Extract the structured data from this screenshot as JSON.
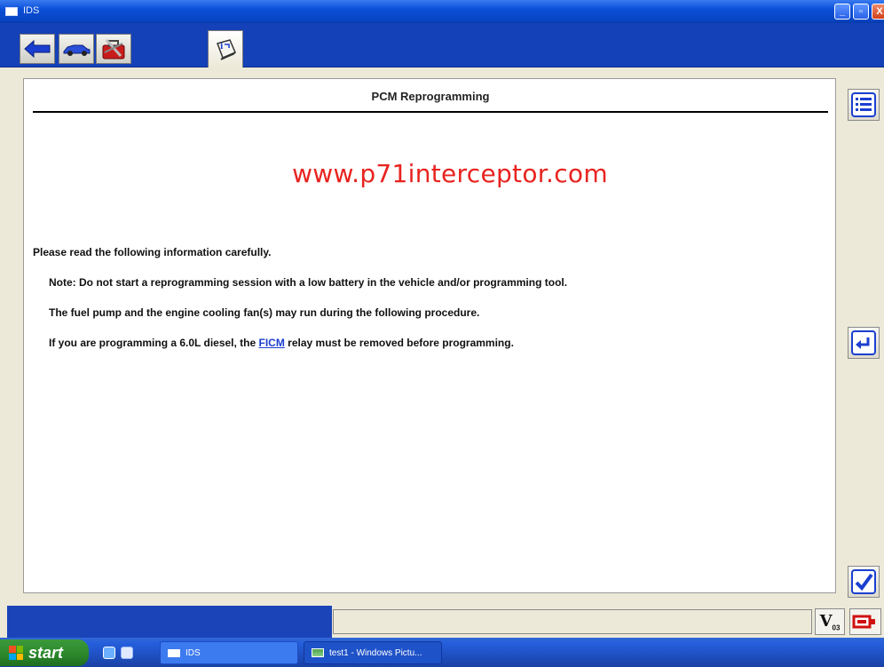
{
  "window": {
    "title": "IDS",
    "controls": {
      "minimize": "_",
      "maximize": "▫",
      "close": "X"
    }
  },
  "toolbar": {
    "buttons": [
      {
        "name": "back",
        "icon": "back-arrow-icon"
      },
      {
        "name": "vehicle",
        "icon": "car-icon"
      },
      {
        "name": "toolbox",
        "icon": "toolbox-icon"
      },
      {
        "name": "info-tab",
        "icon": "info-book-icon"
      }
    ]
  },
  "page": {
    "title": "PCM Reprogramming",
    "watermark": "www.p71interceptor.com",
    "instruction_heading": "Please read the following information carefully.",
    "notes": {
      "note1": "Note: Do not start a reprogramming session with a low battery in the vehicle and/or programming tool.",
      "note2": "The fuel pump and the engine cooling fan(s) may run during the following procedure.",
      "note3_before": "If you are programming a 6.0L diesel, the ",
      "note3_link": "FICM",
      "note3_after": " relay must be removed before programming."
    }
  },
  "side_buttons": {
    "list": "list-icon",
    "return": "return-arrow-icon",
    "confirm": "checkmark-icon"
  },
  "status": {
    "vbat_label": "V",
    "vbat_sub": "03",
    "comm_icon": "vcm-connection-icon"
  },
  "taskbar": {
    "start_label": "start",
    "tasks": [
      {
        "label": "IDS"
      },
      {
        "label": "test1 - Windows Pictu..."
      }
    ]
  },
  "colors": {
    "titlebar": "#0a4fd8",
    "toolbar": "#1541b8",
    "watermark": "#e8231f",
    "link": "#1a3fd0",
    "taskbar": "#245edc",
    "start": "#2d8a2d"
  }
}
